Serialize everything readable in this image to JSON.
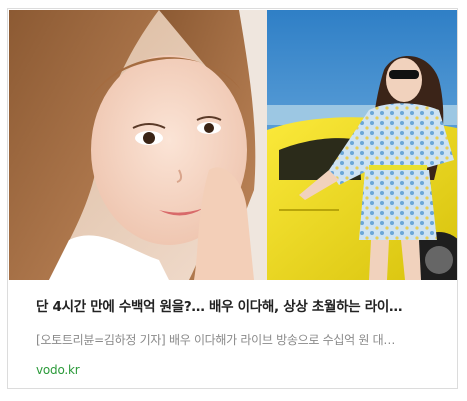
{
  "article": {
    "headline": "단 4시간 만에 수백억 원을?… 배우 이다해, 상상 초월하는 라이…",
    "summary": "[오토트리뷴=김하정 기자] 배우 이다해가 라이브 방송으로 수십억 원 대…",
    "source": "vodo.kr"
  },
  "images": {
    "left": "selfie-photo",
    "right": "car-photo"
  },
  "colors": {
    "source_link": "#2b9a3a",
    "car_yellow": "#f2df18",
    "sky_blue": "#3f8fd0"
  }
}
